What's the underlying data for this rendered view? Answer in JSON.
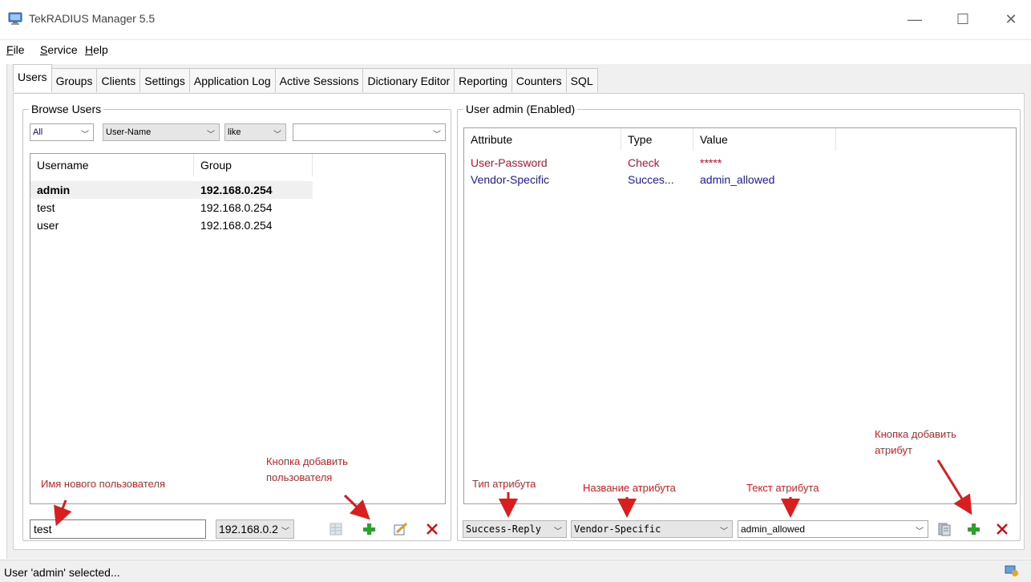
{
  "window": {
    "title": "TekRADIUS Manager 5.5",
    "controls": {
      "minimize": "—",
      "maximize": "☐",
      "close": "✕"
    }
  },
  "menu": [
    {
      "prefix": "",
      "accel": "F",
      "rest": "ile"
    },
    {
      "prefix": "",
      "accel": "S",
      "rest": "ervice"
    },
    {
      "prefix": "",
      "accel": "H",
      "rest": "elp"
    }
  ],
  "tabs": [
    "Users",
    "Groups",
    "Clients",
    "Settings",
    "Application Log",
    "Active Sessions",
    "Dictionary Editor",
    "Reporting",
    "Counters",
    "SQL"
  ],
  "browse": {
    "title": "Browse Users",
    "filter_scope": "All",
    "filter_field": "User-Name",
    "filter_op": "like",
    "filter_value": "",
    "columns": [
      "Username",
      "Group"
    ],
    "rows": [
      {
        "username": "admin",
        "group": "192.168.0.254",
        "selected": true
      },
      {
        "username": "test",
        "group": "192.168.0.254",
        "selected": false
      },
      {
        "username": "user",
        "group": "192.168.0.254",
        "selected": false
      }
    ],
    "new_user_value": "test",
    "new_user_group": "192.168.0.2"
  },
  "user_panel": {
    "title": "User admin (Enabled)",
    "columns": [
      "Attribute",
      "Type",
      "Value"
    ],
    "rows": [
      {
        "attribute": "User-Password",
        "type": "Check",
        "value": "*****",
        "color": "#c0142a"
      },
      {
        "attribute": "Vendor-Specific",
        "type": "Succes...",
        "value": "admin_allowed",
        "color": "#1a1aa8"
      }
    ],
    "attr_type": "Success-Reply",
    "attr_name": "Vendor-Specific",
    "attr_text": "admin_allowed"
  },
  "annotations": {
    "new_user_name": "Имя нового пользователя",
    "add_user_line1": "Кнопка добавить",
    "add_user_line2": "пользователя",
    "attr_type": "Тип атрибута",
    "attr_name": "Название атрибута",
    "attr_text": "Текст атрибута",
    "add_attr_line1": "Кнопка добавить",
    "add_attr_line2": "атрибут"
  },
  "status": {
    "text": "User 'admin' selected..."
  },
  "colors": {
    "annotation": "#d81e1e",
    "add_green": "#2ea02e",
    "delete_red": "#c81414"
  }
}
